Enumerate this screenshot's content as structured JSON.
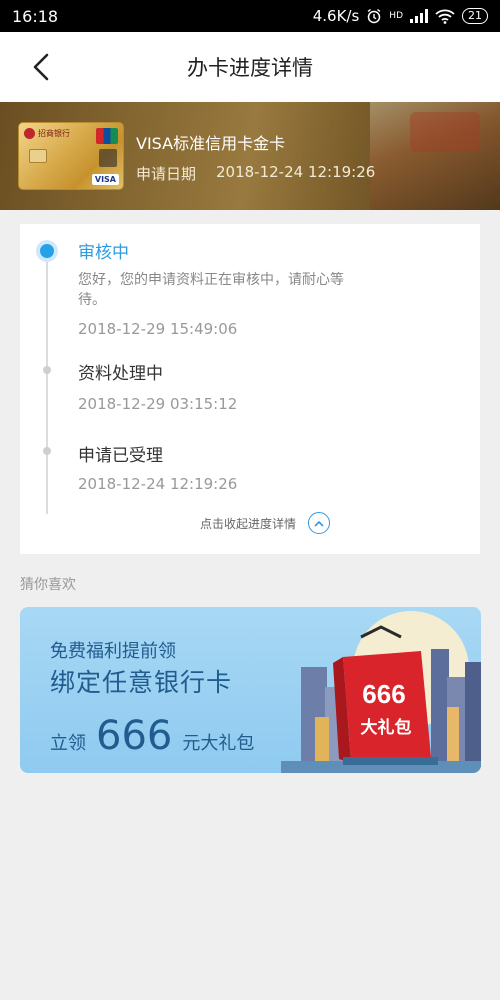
{
  "status_bar": {
    "time": "16:18",
    "speed": "4.6K/s",
    "network": "HD",
    "battery": "21"
  },
  "header": {
    "title": "办卡进度详情"
  },
  "card": {
    "name": "VISA标准信用卡金卡",
    "date_label": "申请日期",
    "date": "2018-12-24 12:19:26",
    "thumb_bank": "招商银行",
    "thumb_visa": "VISA"
  },
  "progress": {
    "steps": [
      {
        "title": "审核中",
        "desc": "您好，您的申请资料正在审核中，请耐心等待。",
        "time": "2018-12-29 15:49:06",
        "active": true
      },
      {
        "title": "资料处理中",
        "time": "2018-12-29 03:15:12",
        "active": false
      },
      {
        "title": "申请已受理",
        "time": "2018-12-24 12:19:26",
        "active": false
      }
    ],
    "collapse_label": "点击收起进度详情"
  },
  "recommend": {
    "section_title": "猜你喜欢",
    "promo": {
      "line1": "免费福利提前领",
      "line2": "绑定任意银行卡",
      "prefix": "立领",
      "number": "666",
      "suffix": "元大礼包",
      "bag_number": "666",
      "bag_text": "大礼包"
    }
  },
  "colors": {
    "accent": "#2f9bdf",
    "promo_bg": "#8fcaf0",
    "bag_red": "#d9242b"
  }
}
